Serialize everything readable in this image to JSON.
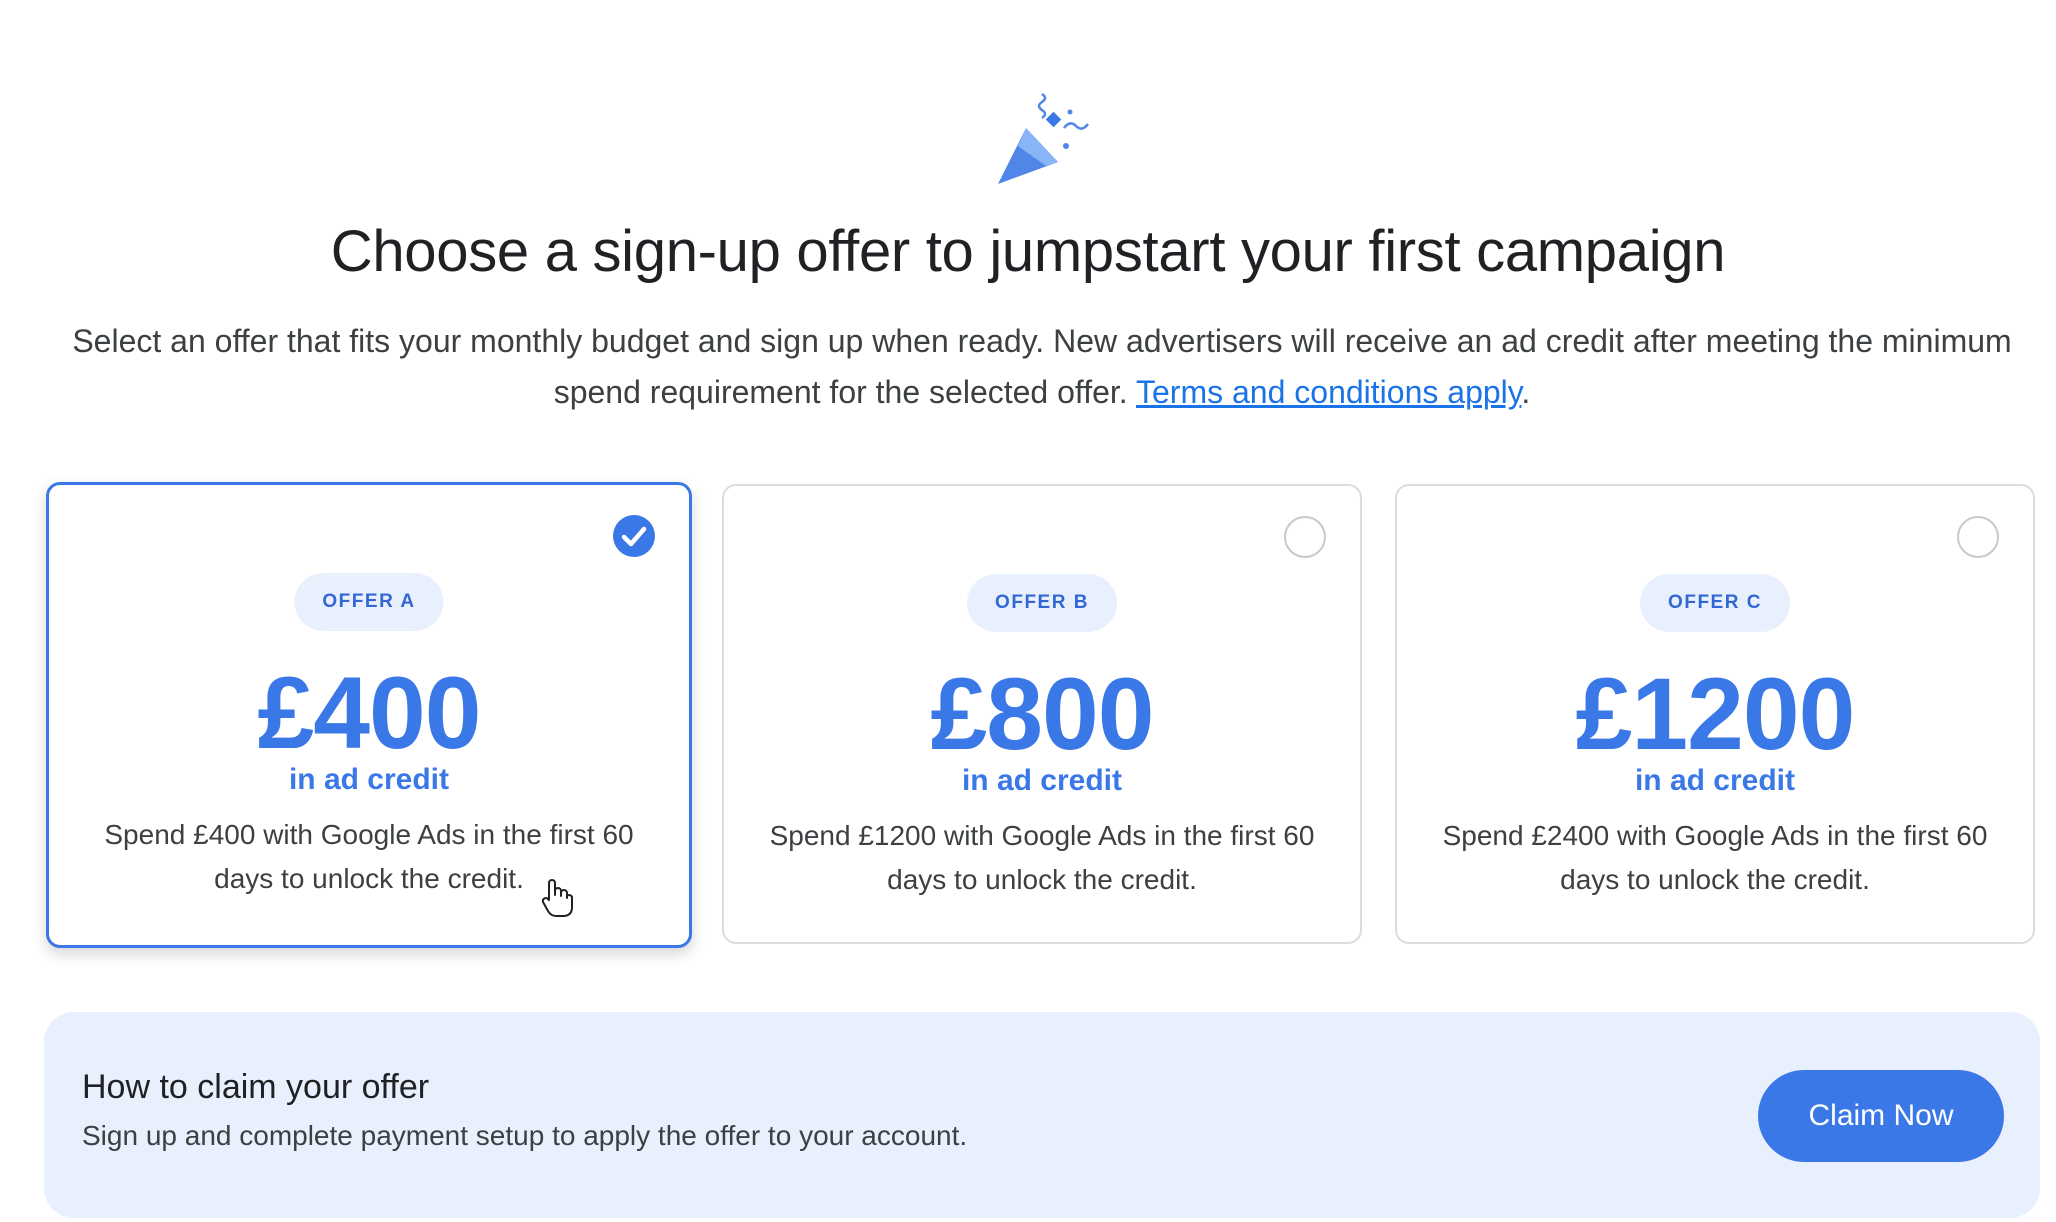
{
  "header": {
    "icon": "party-popper-icon",
    "title": "Choose a sign-up offer to jumpstart your first campaign",
    "subtitle_text": "Select an offer that fits your monthly budget and sign up when ready. New advertisers will receive an ad credit after meeting the minimum spend requirement for the selected offer.",
    "terms_link": "Terms and conditions apply",
    "subtitle_end": "."
  },
  "offers": [
    {
      "badge": "OFFER A",
      "amount": "£400",
      "credit_label": "in ad credit",
      "description": "Spend £400 with Google Ads in the first 60 days to unlock the credit.",
      "selected": true
    },
    {
      "badge": "OFFER B",
      "amount": "£800",
      "credit_label": "in ad credit",
      "description": "Spend £1200 with Google Ads in the first 60 days to unlock the credit.",
      "selected": false
    },
    {
      "badge": "OFFER C",
      "amount": "£1200",
      "credit_label": "in ad credit",
      "description": "Spend £2400 with Google Ads in the first 60 days to unlock the credit.",
      "selected": false
    }
  ],
  "claim": {
    "title": "How to claim your offer",
    "description": "Sign up and complete payment setup to apply the offer to your account.",
    "button_label": "Claim Now"
  },
  "colors": {
    "accent": "#3b78e7",
    "badge_bg": "#e8f0fe",
    "panel_bg": "#e8f0fe"
  }
}
